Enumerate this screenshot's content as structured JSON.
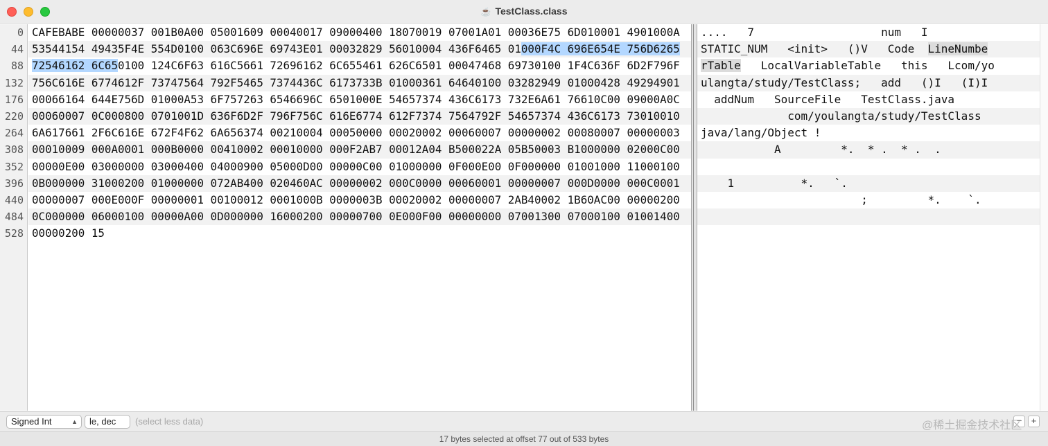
{
  "window": {
    "title": "TestClass.class",
    "doc_icon": "☕"
  },
  "offsets": [
    "0",
    "44",
    "88",
    "132",
    "176",
    "220",
    "264",
    "308",
    "352",
    "396",
    "440",
    "484",
    "528"
  ],
  "hex_rows": [
    [
      "CAFEBABE 00000037 001B0A00 05001609 00040017 09000400 18070019 07001A01 00036E75 6D010001 4901000A"
    ],
    [
      "53544154 49435F4E 554D0100 063C696E 69743E01 00032829 56010004 436F6465 01",
      "000F4C 696E654E 756D6265",
      ""
    ],
    [
      "",
      "72546162 6C65",
      "0100 124C6F63 616C5661 72696162 6C655461 626C6501 00047468 69730100 1F4C636F 6D2F796F"
    ],
    [
      "756C616E 6774612F 73747564 792F5465 7374436C 6173733B 01000361 64640100 03282949 01000428 49294901"
    ],
    [
      "00066164 644E756D 01000A53 6F757263 6546696C 6501000E 54657374 436C6173 732E6A61 76610C00 09000A0C"
    ],
    [
      "00060007 0C000800 0701001D 636F6D2F 796F756C 616E6774 612F7374 7564792F 54657374 436C6173 73010010"
    ],
    [
      "6A617661 2F6C616E 672F4F62 6A656374 00210004 00050000 00020002 00060007 00000002 00080007 00000003"
    ],
    [
      "00010009 000A0001 000B0000 00410002 00010000 000F2AB7 00012A04 B500022A 05B50003 B1000000 02000C00"
    ],
    [
      "00000E00 03000000 03000400 04000900 05000D00 00000C00 01000000 0F000E00 0F000000 01001000 11000100"
    ],
    [
      "0B000000 31000200 01000000 072AB400 020460AC 00000002 000C0000 00060001 00000007 000D0000 000C0001"
    ],
    [
      "00000007 000E000F 00000001 00100012 0001000B 0000003B 00020002 00000007 2AB40002 1B60AC00 00000200"
    ],
    [
      "0C000000 06000100 00000A00 0D000000 16000200 00000700 0E000F00 00000000 07001300 07000100 01001400"
    ],
    [
      "00000200 15"
    ]
  ],
  "ascii_rows": [
    [
      "....   7                   num   I"
    ],
    [
      "STATIC_NUM   <init>   ()V   Code  ",
      "LineNumbe",
      ""
    ],
    [
      "",
      "rTable",
      "   LocalVariableTable   this   Lcom/yo"
    ],
    [
      "ulangta/study/TestClass;   add   ()I   (I)I"
    ],
    [
      "  addNum   SourceFile   TestClass.java"
    ],
    [
      "             com/youlangta/study/TestClass"
    ],
    [
      "java/lang/Object !"
    ],
    [
      "           A         *.  * .  * .  ."
    ],
    [
      ""
    ],
    [
      "    1          *.   `."
    ],
    [
      "                        ;         *.    `."
    ],
    [
      ""
    ],
    [
      ""
    ]
  ],
  "bottom": {
    "type_select": "Signed Int",
    "endian_select": "le, dec",
    "hint": "(select less data)",
    "minus": "−",
    "plus": "+"
  },
  "status": "17 bytes selected at offset 77 out of 533 bytes",
  "watermark": "@稀土掘金技术社区"
}
